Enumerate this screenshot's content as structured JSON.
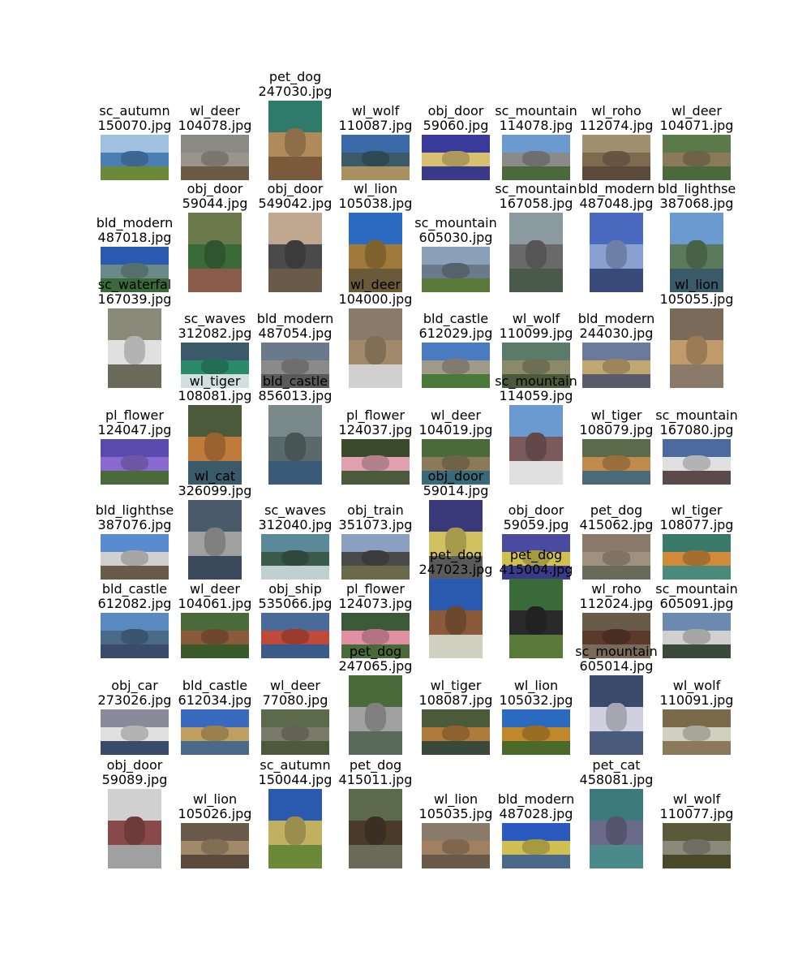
{
  "rows": [
    [
      {
        "category": "sc_autumn",
        "file": "150070.jpg",
        "orient": "land",
        "colors": [
          "#9fc0df",
          "#4a7fb5",
          "#6a8a3a"
        ]
      },
      {
        "category": "wl_deer",
        "file": "104078.jpg",
        "orient": "land",
        "colors": [
          "#8a8a82",
          "#9a958a",
          "#6b5a44"
        ]
      },
      {
        "category": "pet_dog",
        "file": "247030.jpg",
        "orient": "port",
        "colors": [
          "#2f7a6a",
          "#b08a5a",
          "#7a5a3a"
        ]
      },
      {
        "category": "wl_wolf",
        "file": "110087.jpg",
        "orient": "land",
        "colors": [
          "#3a6aa8",
          "#3a5a6a",
          "#a89060"
        ]
      },
      {
        "category": "obj_door",
        "file": "59060.jpg",
        "orient": "land",
        "colors": [
          "#3a3a9a",
          "#d8c070",
          "#3a3a8a"
        ]
      },
      {
        "category": "sc_mountain",
        "file": "114078.jpg",
        "orient": "land",
        "colors": [
          "#6a9ad0",
          "#8a8a8a",
          "#4a6a3a"
        ]
      },
      {
        "category": "wl_roho",
        "file": "112074.jpg",
        "orient": "land",
        "colors": [
          "#a09070",
          "#806a50",
          "#5a4a3a"
        ]
      },
      {
        "category": "wl_deer",
        "file": "104071.jpg",
        "orient": "land",
        "colors": [
          "#5a7a4a",
          "#8a7a5a",
          "#4a6a3a"
        ]
      }
    ],
    [
      {
        "category": "bld_modern",
        "file": "487018.jpg",
        "orient": "land",
        "colors": [
          "#2a5ab0",
          "#6a8a8a",
          "#3a6a3a"
        ]
      },
      {
        "category": "obj_door",
        "file": "59044.jpg",
        "orient": "port",
        "colors": [
          "#6a7a4a",
          "#3a6a3a",
          "#8a5a4a"
        ]
      },
      {
        "category": "obj_door",
        "file": "549042.jpg",
        "orient": "port",
        "colors": [
          "#c0a890",
          "#4a4a4a",
          "#6a5a4a"
        ]
      },
      {
        "category": "wl_lion",
        "file": "105038.jpg",
        "orient": "port",
        "colors": [
          "#2a6ac0",
          "#a07a3a",
          "#6a5a3a"
        ]
      },
      {
        "category": "sc_mountain",
        "file": "605030.jpg",
        "orient": "land",
        "colors": [
          "#8aa0b8",
          "#6a7a8a",
          "#5a7a3a"
        ]
      },
      {
        "category": "sc_mountain",
        "file": "167058.jpg",
        "orient": "port",
        "colors": [
          "#8a9aa0",
          "#6a6a6a",
          "#4a5a4a"
        ]
      },
      {
        "category": "bld_modern",
        "file": "487048.jpg",
        "orient": "port",
        "colors": [
          "#4a6ac0",
          "#8aa0d0",
          "#3a4a7a"
        ]
      },
      {
        "category": "bld_lighthse",
        "file": "387068.jpg",
        "orient": "port",
        "colors": [
          "#6a9ad0",
          "#5a7a5a",
          "#3a5a6a"
        ]
      }
    ],
    [
      {
        "category": "sc_waterfal",
        "file": "167039.jpg",
        "orient": "port",
        "colors": [
          "#8a8a7a",
          "#e0e0e0",
          "#6a6a5a"
        ]
      },
      {
        "category": "sc_waves",
        "file": "312082.jpg",
        "orient": "land",
        "colors": [
          "#3a5a6a",
          "#2a8a6a",
          "#d0e0e0"
        ]
      },
      {
        "category": "bld_modern",
        "file": "487054.jpg",
        "orient": "land",
        "colors": [
          "#6a7a8a",
          "#8a8a8a",
          "#5a5a5a"
        ]
      },
      {
        "category": "wl_deer",
        "file": "104000.jpg",
        "orient": "port",
        "colors": [
          "#8a7a6a",
          "#a08a6a",
          "#d0d0d0"
        ]
      },
      {
        "category": "bld_castle",
        "file": "612029.jpg",
        "orient": "land",
        "colors": [
          "#4a7ac0",
          "#a09a8a",
          "#4a7a3a"
        ]
      },
      {
        "category": "wl_wolf",
        "file": "110099.jpg",
        "orient": "land",
        "colors": [
          "#5a7a6a",
          "#8a8a6a",
          "#4a5a3a"
        ]
      },
      {
        "category": "bld_modern",
        "file": "244030.jpg",
        "orient": "land",
        "colors": [
          "#6a7a9a",
          "#c0a870",
          "#5a5a6a"
        ]
      },
      {
        "category": "wl_lion",
        "file": "105055.jpg",
        "orient": "port",
        "colors": [
          "#7a6a5a",
          "#c09a6a",
          "#8a7a6a"
        ]
      }
    ],
    [
      {
        "category": "pl_flower",
        "file": "124047.jpg",
        "orient": "land",
        "colors": [
          "#5a4ab0",
          "#8a6ad0",
          "#4a6a3a"
        ]
      },
      {
        "category": "wl_tiger",
        "file": "108081.jpg",
        "orient": "port",
        "colors": [
          "#4a5a3a",
          "#c07a3a",
          "#3a5a6a"
        ]
      },
      {
        "category": "bld_castle",
        "file": "856013.jpg",
        "orient": "port",
        "colors": [
          "#7a8a8a",
          "#5a6a6a",
          "#3a5a7a"
        ]
      },
      {
        "category": "pl_flower",
        "file": "124037.jpg",
        "orient": "land",
        "colors": [
          "#3a4a2a",
          "#e0a0b0",
          "#4a5a3a"
        ]
      },
      {
        "category": "wl_deer",
        "file": "104019.jpg",
        "orient": "land",
        "colors": [
          "#4a6a3a",
          "#8a7a5a",
          "#3a6a7a"
        ]
      },
      {
        "category": "sc_mountain",
        "file": "114059.jpg",
        "orient": "port",
        "colors": [
          "#6a9ad0",
          "#7a5a5a",
          "#e0e0e0"
        ]
      },
      {
        "category": "wl_tiger",
        "file": "108079.jpg",
        "orient": "land",
        "colors": [
          "#5a6a4a",
          "#c08a4a",
          "#4a6a7a"
        ]
      },
      {
        "category": "sc_mountain",
        "file": "167080.jpg",
        "orient": "land",
        "colors": [
          "#4a6aa0",
          "#e0e0e0",
          "#5a4a4a"
        ]
      }
    ],
    [
      {
        "category": "bld_lighthse",
        "file": "387076.jpg",
        "orient": "land",
        "colors": [
          "#5a8ad0",
          "#d0d0d0",
          "#6a5a4a"
        ]
      },
      {
        "category": "wl_cat",
        "file": "326099.jpg",
        "orient": "port",
        "colors": [
          "#4a5a6a",
          "#a0a0a0",
          "#3a4a5a"
        ]
      },
      {
        "category": "sc_waves",
        "file": "312040.jpg",
        "orient": "land",
        "colors": [
          "#5a8a9a",
          "#3a5a4a",
          "#c0d0d0"
        ]
      },
      {
        "category": "obj_train",
        "file": "351073.jpg",
        "orient": "land",
        "colors": [
          "#8aa0c0",
          "#4a4a4a",
          "#6a6a4a"
        ]
      },
      {
        "category": "obj_door",
        "file": "59014.jpg",
        "orient": "port",
        "colors": [
          "#3a3a7a",
          "#d0c060",
          "#5a5a5a"
        ]
      },
      {
        "category": "obj_door",
        "file": "59059.jpg",
        "orient": "land",
        "colors": [
          "#4a4aa0",
          "#d0c050",
          "#3a3a8a"
        ]
      },
      {
        "category": "pet_dog",
        "file": "415062.jpg",
        "orient": "land",
        "colors": [
          "#8a7a6a",
          "#a09080",
          "#6a6a5a"
        ]
      },
      {
        "category": "wl_tiger",
        "file": "108077.jpg",
        "orient": "land",
        "colors": [
          "#3a7a6a",
          "#d08a3a",
          "#4a8a7a"
        ]
      }
    ],
    [
      {
        "category": "bld_castle",
        "file": "612082.jpg",
        "orient": "land",
        "colors": [
          "#5a8ac0",
          "#4a6a8a",
          "#3a4a6a"
        ]
      },
      {
        "category": "wl_deer",
        "file": "104061.jpg",
        "orient": "land",
        "colors": [
          "#4a6a3a",
          "#8a5a3a",
          "#3a5a2a"
        ]
      },
      {
        "category": "obj_ship",
        "file": "535066.jpg",
        "orient": "land",
        "colors": [
          "#4a6a9a",
          "#c04a3a",
          "#3a5a8a"
        ]
      },
      {
        "category": "pl_flower",
        "file": "124073.jpg",
        "orient": "land",
        "colors": [
          "#3a5a3a",
          "#e090a0",
          "#4a6a3a"
        ]
      },
      {
        "category": "pet_dog",
        "file": "247023.jpg",
        "orient": "port",
        "colors": [
          "#2a5ab0",
          "#8a5a3a",
          "#d0d0c0"
        ]
      },
      {
        "category": "pet_dog",
        "file": "415004.jpg",
        "orient": "port",
        "colors": [
          "#3a6a3a",
          "#2a2a2a",
          "#5a7a3a"
        ]
      },
      {
        "category": "wl_roho",
        "file": "112024.jpg",
        "orient": "land",
        "colors": [
          "#6a5a4a",
          "#5a3a2a",
          "#7a6a5a"
        ]
      },
      {
        "category": "sc_mountain",
        "file": "605091.jpg",
        "orient": "land",
        "colors": [
          "#6a8ab0",
          "#d0d0d0",
          "#3a4a3a"
        ]
      }
    ],
    [
      {
        "category": "obj_car",
        "file": "273026.jpg",
        "orient": "land",
        "colors": [
          "#8a8a9a",
          "#e0e0e0",
          "#3a4a6a"
        ]
      },
      {
        "category": "bld_castle",
        "file": "612034.jpg",
        "orient": "land",
        "colors": [
          "#3a6ac0",
          "#c0a060",
          "#4a6a8a"
        ]
      },
      {
        "category": "wl_deer",
        "file": "77080.jpg",
        "orient": "land",
        "colors": [
          "#5a6a4a",
          "#7a7a6a",
          "#4a5a3a"
        ]
      },
      {
        "category": "pet_dog",
        "file": "247065.jpg",
        "orient": "port",
        "colors": [
          "#4a6a3a",
          "#a0a0a0",
          "#5a6a5a"
        ]
      },
      {
        "category": "wl_tiger",
        "file": "108087.jpg",
        "orient": "land",
        "colors": [
          "#4a5a3a",
          "#b07a3a",
          "#3a4a3a"
        ]
      },
      {
        "category": "wl_lion",
        "file": "105032.jpg",
        "orient": "land",
        "colors": [
          "#2a6ac0",
          "#c0882a",
          "#4a6a2a"
        ]
      },
      {
        "category": "sc_mountain",
        "file": "605014.jpg",
        "orient": "port",
        "colors": [
          "#3a4a6a",
          "#d0d0e0",
          "#4a5a7a"
        ]
      },
      {
        "category": "wl_wolf",
        "file": "110091.jpg",
        "orient": "land",
        "colors": [
          "#7a6a4a",
          "#d0d0c0",
          "#8a7a5a"
        ]
      }
    ],
    [
      {
        "category": "obj_door",
        "file": "59089.jpg",
        "orient": "port",
        "colors": [
          "#d0d0d0",
          "#8a4a4a",
          "#a0a0a0"
        ]
      },
      {
        "category": "wl_lion",
        "file": "105026.jpg",
        "orient": "land",
        "colors": [
          "#6a5a4a",
          "#a08a6a",
          "#5a4a3a"
        ]
      },
      {
        "category": "sc_autumn",
        "file": "150044.jpg",
        "orient": "port",
        "colors": [
          "#2a5ab0",
          "#c0b060",
          "#6a8a3a"
        ]
      },
      {
        "category": "pet_dog",
        "file": "415011.jpg",
        "orient": "port",
        "colors": [
          "#5a6a4a",
          "#4a3a2a",
          "#6a6a5a"
        ]
      },
      {
        "category": "wl_lion",
        "file": "105035.jpg",
        "orient": "land",
        "colors": [
          "#8a7a6a",
          "#a08060",
          "#6a5a4a"
        ]
      },
      {
        "category": "bld_modern",
        "file": "487028.jpg",
        "orient": "land",
        "colors": [
          "#2a5ac0",
          "#d0c050",
          "#4a6a8a"
        ]
      },
      {
        "category": "pet_cat",
        "file": "458081.jpg",
        "orient": "port",
        "colors": [
          "#3a7a7a",
          "#6a6a8a",
          "#4a8a8a"
        ]
      },
      {
        "category": "wl_wolf",
        "file": "110077.jpg",
        "orient": "land",
        "colors": [
          "#5a5a3a",
          "#8a8a7a",
          "#4a4a2a"
        ]
      }
    ]
  ]
}
